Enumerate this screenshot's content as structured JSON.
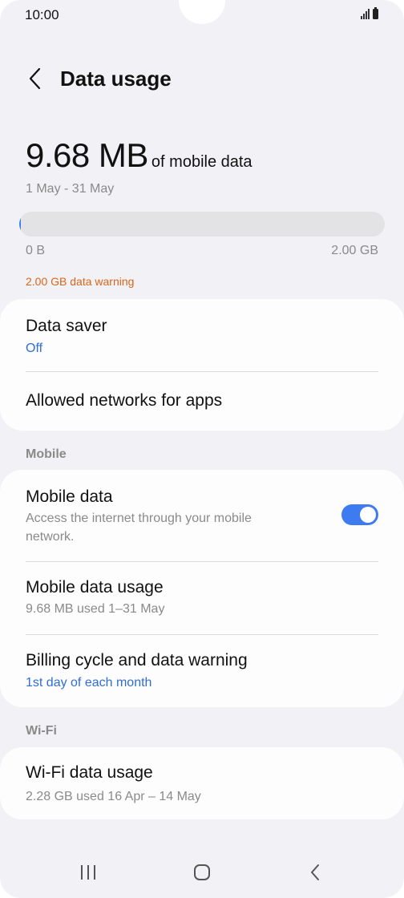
{
  "status_bar": {
    "time": "10:00"
  },
  "header": {
    "title": "Data usage"
  },
  "usage": {
    "amount": "9.68 MB",
    "suffix": "of mobile data",
    "date_range": "1 May - 31 May",
    "progress_fraction": 0.005,
    "scale_min": "0 B",
    "scale_max": "2.00 GB",
    "warning": "2.00 GB data warning"
  },
  "card_general": {
    "data_saver": {
      "title": "Data saver",
      "status": "Off"
    },
    "allowed_networks": {
      "title": "Allowed networks for apps"
    }
  },
  "section_mobile": {
    "label": "Mobile"
  },
  "card_mobile": {
    "mobile_data": {
      "title": "Mobile data",
      "description": "Access the internet through your mobile network.",
      "enabled": true
    },
    "mobile_data_usage": {
      "title": "Mobile data usage",
      "detail": "9.68 MB used 1–31 May"
    },
    "billing_cycle": {
      "title": "Billing cycle and data warning",
      "detail": "1st day of each month"
    }
  },
  "section_wifi": {
    "label": "Wi-Fi"
  },
  "card_wifi": {
    "wifi_data_usage": {
      "title": "Wi-Fi data usage",
      "detail": "2.28 GB used 16 Apr – 14 May"
    }
  },
  "colors": {
    "accent": "#3e7bf0",
    "link_blue": "#2f6fd1",
    "warning_orange": "#d9651a",
    "background": "#f2f2f6",
    "card": "#fdfdfd"
  },
  "icons": {
    "back": "chevron-left-icon",
    "signal": "signal-icon",
    "battery": "battery-icon",
    "recents": "recents-icon",
    "home": "home-icon",
    "nav_back": "nav-back-icon"
  }
}
